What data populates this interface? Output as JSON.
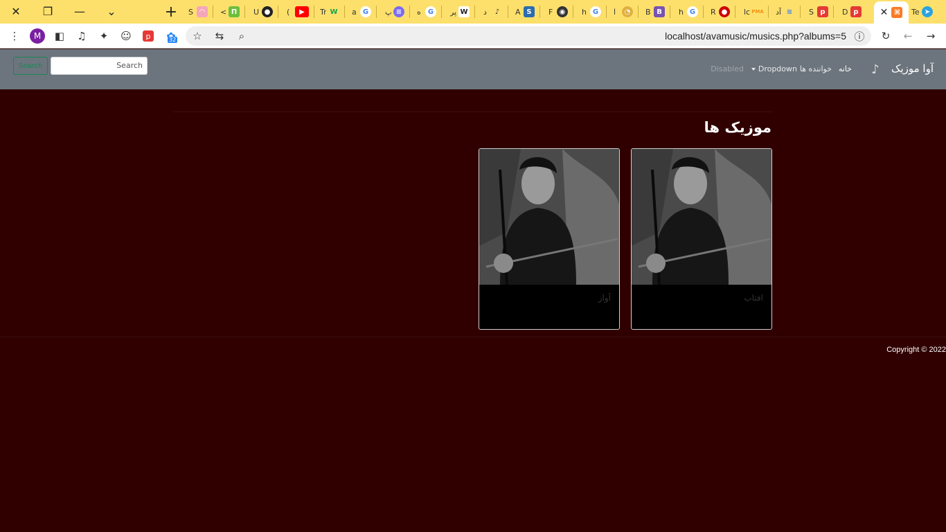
{
  "browser": {
    "tabs": [
      {
        "title": "S",
        "icon": "rainbow-icon",
        "color": "#f4a7b9"
      },
      {
        "title": "<",
        "icon": "code-icon",
        "color": "#6bbf3a"
      },
      {
        "title": "U",
        "icon": "github-icon",
        "color": "#222222"
      },
      {
        "title": "(",
        "icon": "youtube-icon",
        "color": "#ff0000"
      },
      {
        "title": "Tr",
        "icon": "w-icon",
        "color": "#16a34a"
      },
      {
        "title": "a",
        "icon": "google-icon",
        "color": "#4285f4"
      },
      {
        "title": "پ",
        "icon": "app-icon",
        "color": "#7c6cf0"
      },
      {
        "title": "ه",
        "icon": "google-icon",
        "color": "#4285f4"
      },
      {
        "title": "پر",
        "icon": "wikipedia-icon",
        "color": "#222222"
      },
      {
        "title": "د",
        "icon": "music-icon",
        "color": "#333333"
      },
      {
        "title": "A",
        "icon": "app-icon",
        "color": "#2b6cb0"
      },
      {
        "title": "F",
        "icon": "app-icon",
        "color": "#333333"
      },
      {
        "title": "h",
        "icon": "google-icon",
        "color": "#4285f4"
      },
      {
        "title": "ا",
        "icon": "app-icon",
        "color": "#e0b040"
      },
      {
        "title": "B",
        "icon": "bootstrap-icon",
        "color": "#7952b3"
      },
      {
        "title": "h",
        "icon": "google-icon",
        "color": "#4285f4"
      },
      {
        "title": "R",
        "icon": "app-icon",
        "color": "#cc0000"
      },
      {
        "title": "lc",
        "icon": "phpmyadmin-icon",
        "color": "#f29111"
      },
      {
        "title": "آد",
        "icon": "app-icon",
        "color": "#3b82f6"
      },
      {
        "title": "S",
        "icon": "p-icon",
        "color": "#e53935"
      },
      {
        "title": "D",
        "icon": "p-icon",
        "color": "#e53935"
      }
    ],
    "active_tab_icon": "xampp-icon",
    "last_tab": {
      "title": "Te",
      "icon": "telegram-icon"
    },
    "url": "localhost/avamusic/musics.php?albums=5",
    "profile_initial": "M",
    "extension_badge": "32"
  },
  "navbar": {
    "brand": "آوا موزیک",
    "home": "خانه",
    "singers": "خواننده ها",
    "dropdown": "Dropdown",
    "disabled": "Disabled",
    "search_placeholder": "Search",
    "search_button": "Search"
  },
  "main": {
    "title": "موزیک ها",
    "cards": [
      {
        "label": "افتاب"
      },
      {
        "label": "آواز"
      }
    ]
  },
  "footer": {
    "copyright": "Copyright © 2022"
  }
}
